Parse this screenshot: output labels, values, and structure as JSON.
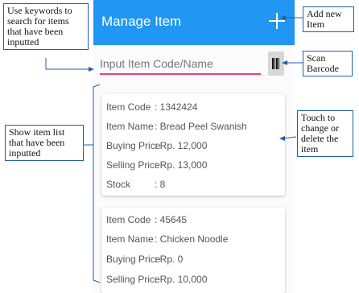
{
  "app": {
    "title": "Manage Item",
    "add_icon": "plus-icon",
    "search_placeholder": "Input Item Code/Name",
    "barcode_icon": "barcode-icon",
    "accent": "#2196f3",
    "underline": "#e8407a"
  },
  "items": [
    {
      "code_label": "Item Code",
      "code_value": ": 1342424",
      "name_label": "Item Name",
      "name_value": ": Bread Peel Swanish",
      "buy_label": "Buying Price",
      "buy_value": ": Rp. 12,000",
      "sell_label": "Selling Price",
      "sell_value": ": Rp. 13,000",
      "stock_label": "Stock",
      "stock_value": ": 8"
    },
    {
      "code_label": "Item Code",
      "code_value": ": 45645",
      "name_label": "Item Name",
      "name_value": ": Chicken Noodle",
      "buy_label": "Buying Price",
      "buy_value": ": Rp. 0",
      "sell_label": "Selling Price",
      "sell_value": ": Rp. 10,000"
    }
  ],
  "notes": {
    "keywords": "Use keywords to search for items that have been inputted",
    "add": "Add new Item",
    "scan": "Scan Barcode",
    "list": "Show item list that have been inputted",
    "touch": "Touch to change or delete the item"
  }
}
